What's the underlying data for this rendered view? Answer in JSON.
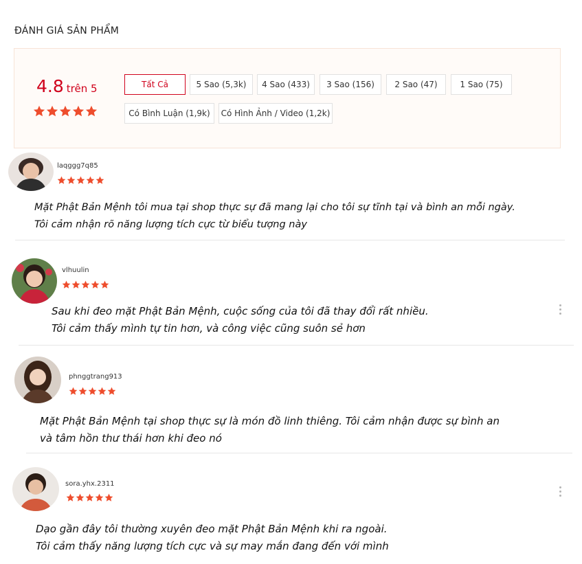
{
  "section_title": "ĐÁNH GIÁ SẢN PHẨM",
  "summary": {
    "score": "4.8",
    "score_suffix": "trên 5",
    "stars": 5
  },
  "filters": [
    {
      "label": "Tất Cả",
      "active": true
    },
    {
      "label": "5 Sao (5,3k)",
      "active": false
    },
    {
      "label": "4 Sao (433)",
      "active": false
    },
    {
      "label": "3 Sao (156)",
      "active": false
    },
    {
      "label": "2 Sao (47)",
      "active": false
    },
    {
      "label": "1 Sao (75)",
      "active": false
    },
    {
      "label": "Có Bình Luận (1,9k)",
      "active": false
    },
    {
      "label": "Có Hình Ảnh / Video (1,2k)",
      "active": false
    }
  ],
  "reviews": [
    {
      "username": "laqggg7q85",
      "stars": 5,
      "lines": [
        "Mặt Phật Bản Mệnh tôi mua tại shop thực sự đã mang lại cho tôi sự tĩnh tại và bình an mỗi ngày.",
        "Tôi cảm nhận rõ năng lượng tích cực từ biểu tượng này"
      ]
    },
    {
      "username": "vlhuulin",
      "stars": 5,
      "lines": [
        "Sau khi đeo mặt Phật Bản Mệnh, cuộc sống của tôi đã thay đổi rất nhiều.",
        "Tôi cảm thấy mình tự tin hơn, và công việc cũng suôn sẻ hơn"
      ]
    },
    {
      "username": "phnggtrang913",
      "stars": 5,
      "lines": [
        "Mặt Phật Bản Mệnh tại shop thực sự là món đồ linh thiêng. Tôi cảm nhận được sự bình an",
        "và tâm hồn thư thái hơn khi đeo nó"
      ]
    },
    {
      "username": "sora.yhx.2311",
      "stars": 5,
      "lines": [
        "Dạo gần đây tôi thường xuyên đeo mặt Phật Bản Mệnh khi ra ngoài.",
        "Tôi cảm thấy năng lượng tích cực và sự may mắn đang đến với mình"
      ]
    }
  ],
  "colors": {
    "accent": "#d0011b",
    "star": "#ee4d2d"
  },
  "icons": {
    "star": "star-icon",
    "more": "more-options-icon"
  }
}
